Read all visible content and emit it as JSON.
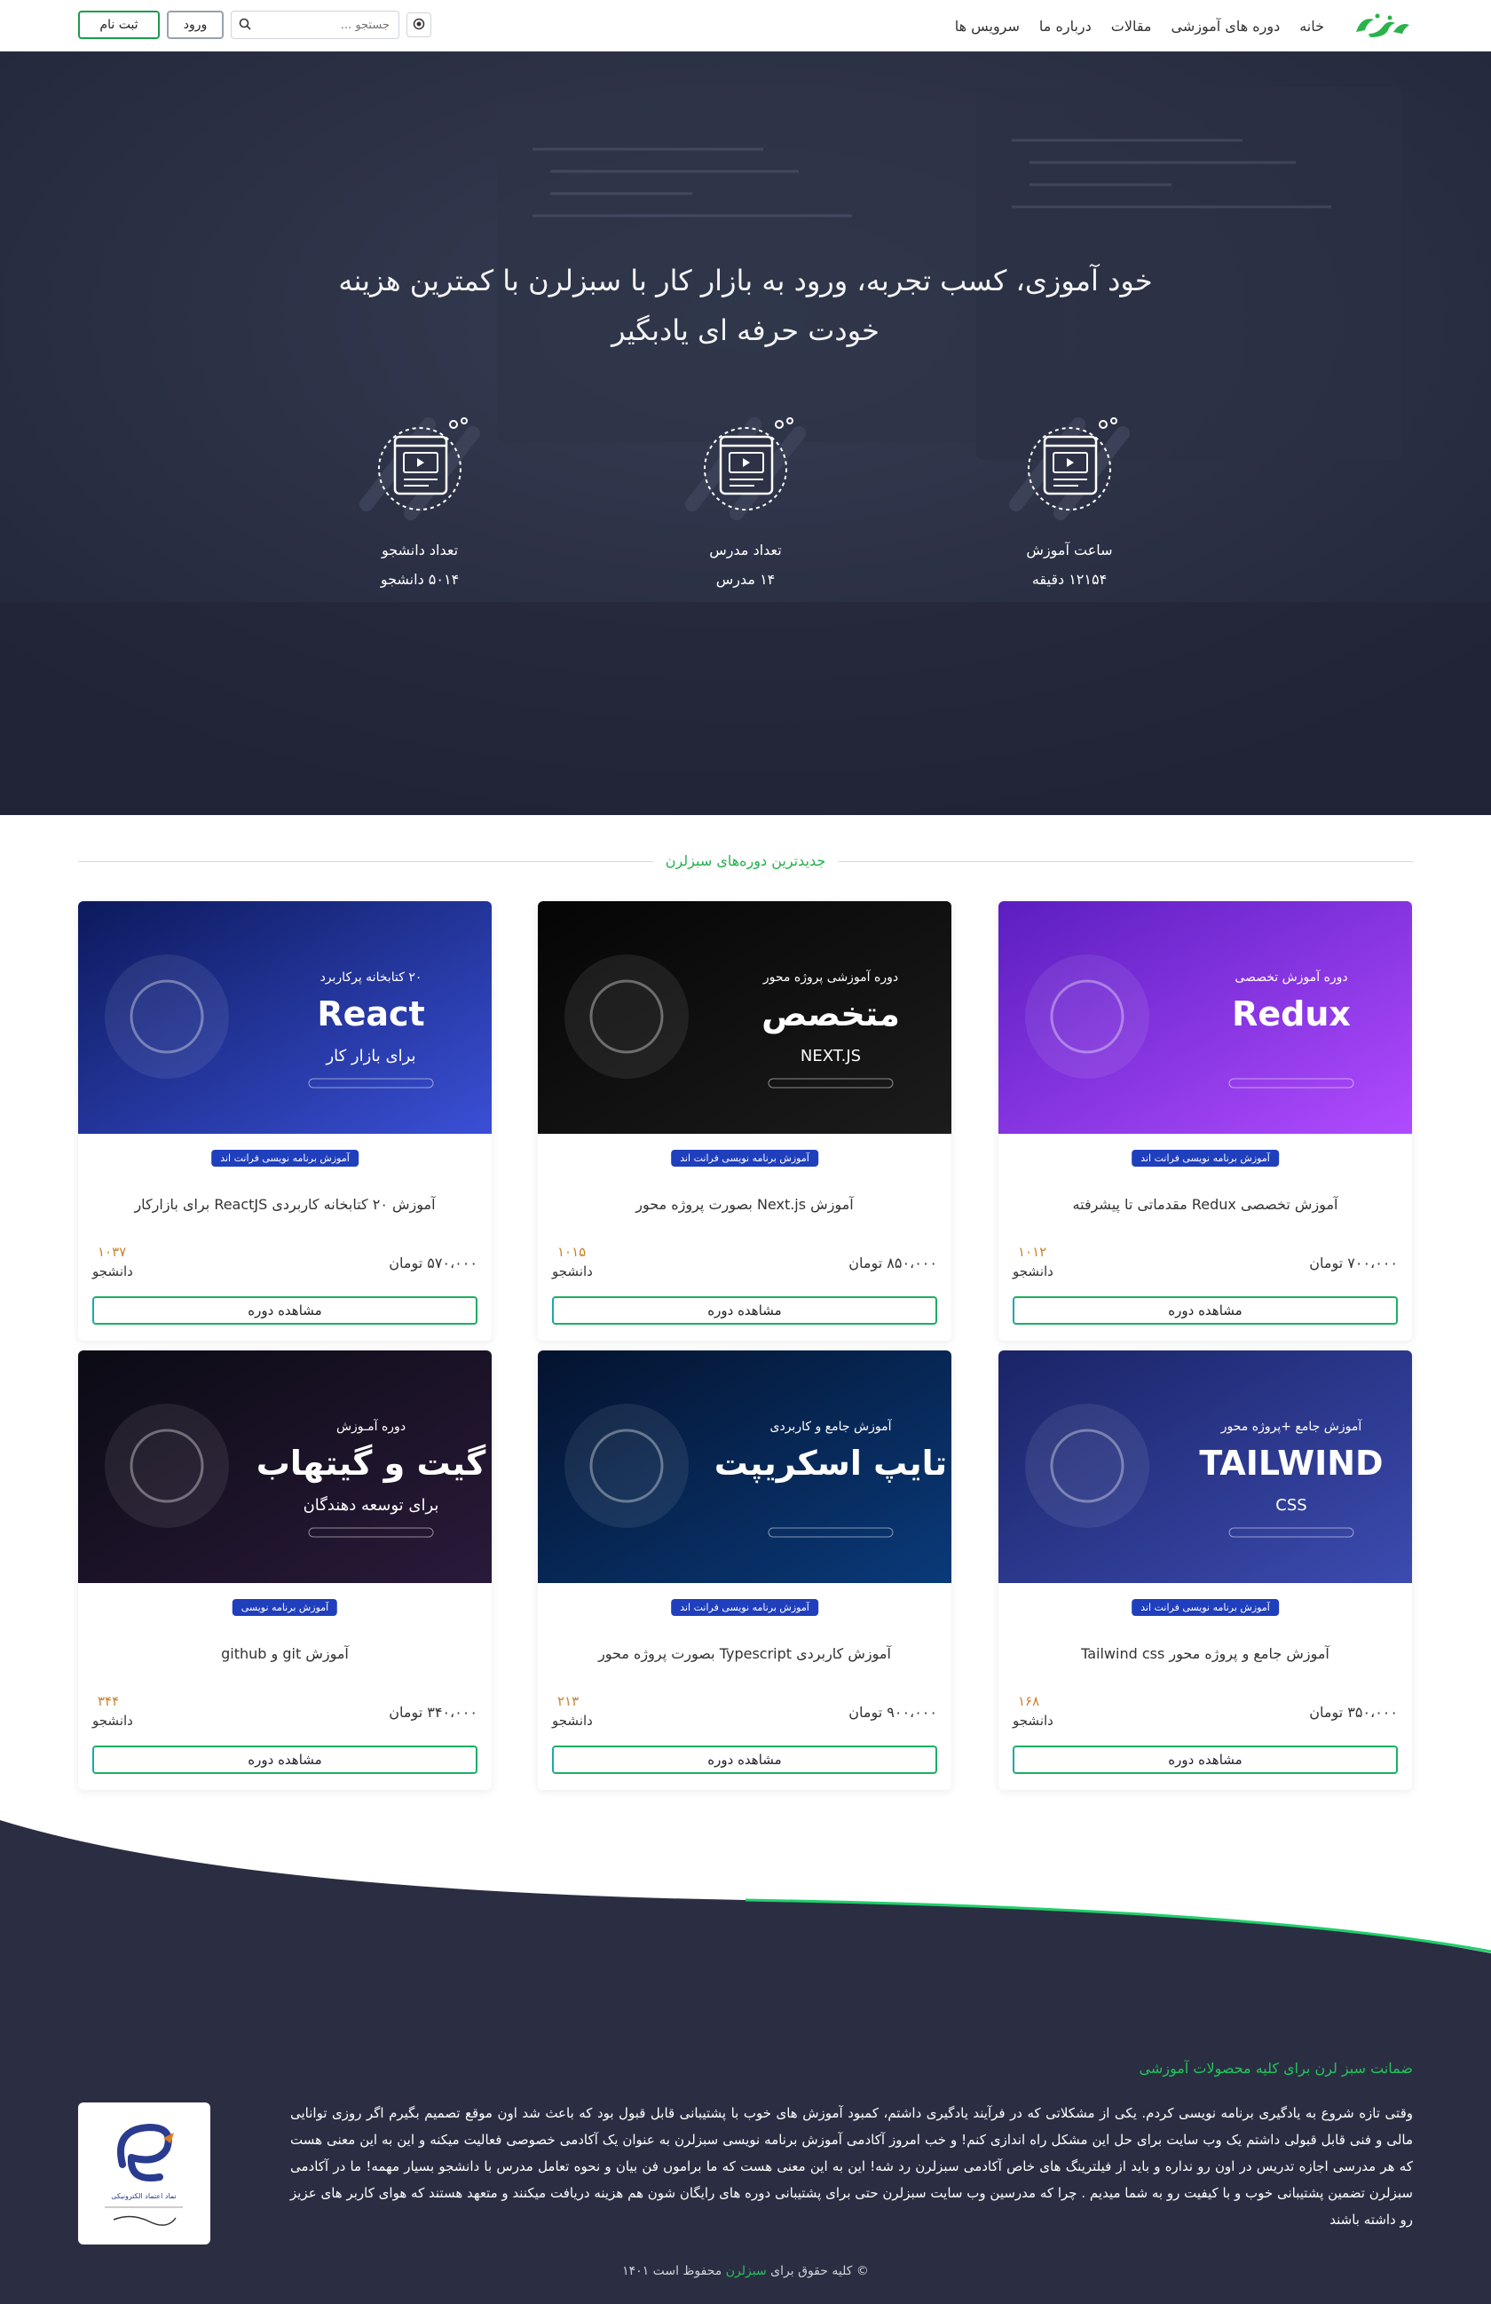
{
  "navbar": {
    "logo_text": "سبزلرن",
    "links": [
      "خانه",
      "دوره های آموزشی",
      "مقالات",
      "درباره ما",
      "سرویس ها"
    ],
    "search_placeholder": "جستجو ...",
    "login_label": "ورود",
    "register_label": "ثبت نام"
  },
  "hero": {
    "title_line1": "خود آموزی، کسب تجربه، ورود به بازار کار با سبزلرن با کمترین هزینه",
    "title_line2": "خودت حرفه ای یادبگیر",
    "stats": [
      {
        "label": "ساعت آموزش",
        "value": "۱۲۱۵۴ دقیقه"
      },
      {
        "label": "تعداد مدرس",
        "value": "۱۴ مدرس"
      },
      {
        "label": "تعداد دانشجو",
        "value": "۵۰۱۴ دانشجو"
      }
    ]
  },
  "courses": {
    "section_title": "جدیدترین دوره‌های سبزلرن",
    "view_label": "مشاهده دوره",
    "student_label": "دانشجو",
    "items": [
      {
        "badge": "آموزش برنامه نویسی فرانت اند",
        "title": "آموزش تخصصی Redux مقدماتی تا پیشرفته",
        "price": "۷۰۰،۰۰۰ تومان",
        "students": "۱۰۱۲",
        "thumb": {
          "line1": "دوره آموزش تخصصی",
          "line2": "Redux",
          "line3": "",
          "colors": [
            "#5b1ec0",
            "#b04bff"
          ]
        }
      },
      {
        "badge": "آموزش برنامه نویسی فرانت اند",
        "title": "آموزش Next.js بصورت پروژه محور",
        "price": "۸۵۰،۰۰۰ تومان",
        "students": "۱۰۱۵",
        "thumb": {
          "line1": "دوره آموزشی پروژه محور",
          "line2": "متخصص",
          "line3": "NEXT.JS",
          "colors": [
            "#050505",
            "#1c1c1c"
          ]
        }
      },
      {
        "badge": "آموزش برنامه نویسی فرانت اند",
        "title": "آموزش ۲۰ کتابخانه کاربردی ReactJS برای بازارکار",
        "price": "۵۷۰،۰۰۰ تومان",
        "students": "۱۰۳۷",
        "thumb": {
          "line1": "۲۰ کتابخانه پرکاربرد",
          "line2": "React",
          "line3": "برای بازار کار",
          "colors": [
            "#0c1a5c",
            "#3a4fd6"
          ]
        }
      },
      {
        "badge": "آموزش برنامه نویسی فرانت اند",
        "title": "آموزش جامع و پروژه محور Tailwind css",
        "price": "۳۵۰،۰۰۰ تومان",
        "students": "۱۶۸",
        "thumb": {
          "line1": "آموزش جامع +پروژه محور",
          "line2": "TAILWIND",
          "line3": "CSS",
          "colors": [
            "#1a2466",
            "#3c4bb0"
          ]
        }
      },
      {
        "badge": "آموزش برنامه نویسی فرانت اند",
        "title": "آموزش کاربردی Typescript بصورت پروژه محور",
        "price": "۹۰۰،۰۰۰ تومان",
        "students": "۲۱۳",
        "thumb": {
          "line1": "آموزش جامع و کاربردی",
          "line2": "تایپ اسکریپت",
          "line3": "",
          "colors": [
            "#04132e",
            "#0a3a7a"
          ]
        }
      },
      {
        "badge": "آموزش برنامه نویسی",
        "title": "آموزش git و github",
        "price": "۳۴۰،۰۰۰ تومان",
        "students": "۳۴۴",
        "thumb": {
          "line1": "دوره آمـوزش",
          "line2": "گیت و گیتهاب",
          "line3": "برای توسعه دهندگان",
          "colors": [
            "#0b0b14",
            "#2a1a3a"
          ]
        }
      }
    ]
  },
  "footer": {
    "heading": "ضمانت سبز لرن برای کلیه محصولات آموزشی",
    "text": "وقتی تازه شروع به یادگیری برنامه نویسی کردم. یکی از مشکلاتی که در فرآیند یادگیری داشتم، کمبود آموزش های خوب با پشتیبانی قابل قبول بود که باعث شد اون موقع تصمیم بگیرم اگر روزی توانایی مالی و فنی قابل قبولی داشتم یک وب سایت برای حل این مشکل راه اندازی کنم! و خب امروز آکادمی آموزش برنامه نویسی سبزلرن به عنوان یک آکادمی خصوصی فعالیت میکنه و این به این معنی هست که هر مدرسی اجازه تدریس در اون رو نداره و باید از فیلترینگ های خاص آکادمی سبزلرن رد شه! این به این معنی هست که ما براموں فن بیان و نحوه تعامل مدرس با دانشجو بسیار مهمه! ما در آکادمی سبزلرن تضمین پشتیبانی خوب و با کیفیت رو به شما میدیم . چرا که مدرسین وب سایت سبزلرن حتی برای پشتیبانی دوره های رایگان شون هم هزینه دریافت میکنند و متعهد هستند که هوای کاربر های عزیز رو داشته باشند",
    "enamad_text": "نماد اعتماد الکترونیکی",
    "copyright_prefix": "© کلیه حقوق برای",
    "copyright_brand": "سبزلرن",
    "copyright_suffix": "محفوظ است ۱۴۰۱"
  }
}
